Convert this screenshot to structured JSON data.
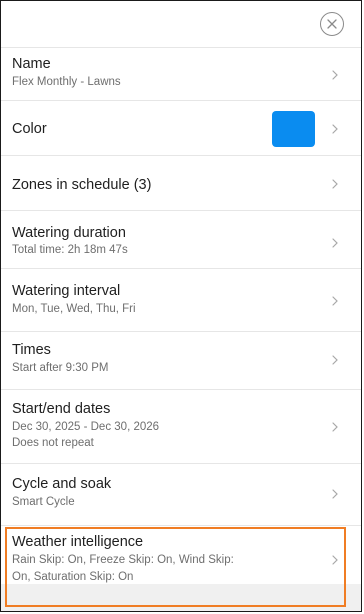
{
  "schedule": {
    "rows": [
      {
        "title": "Name",
        "subtitle": [
          "Flex Monthly - Lawns"
        ]
      },
      {
        "title": "Color",
        "subtitle": [],
        "swatch_color": "#0a8cf0"
      },
      {
        "title": "Zones in schedule (3)",
        "subtitle": []
      },
      {
        "title": "Watering duration",
        "subtitle": [
          "Total time: 2h 18m 47s"
        ]
      },
      {
        "title": "Watering interval",
        "subtitle": [
          "Mon, Tue, Wed, Thu, Fri"
        ]
      },
      {
        "title": "Times",
        "subtitle": [
          "Start after 9:30 PM"
        ]
      },
      {
        "title": "Start/end dates",
        "subtitle": [
          "Dec 30, 2025 - Dec 30, 2026",
          "Does not repeat"
        ]
      },
      {
        "title": "Cycle and soak",
        "subtitle": [
          "Smart Cycle"
        ]
      },
      {
        "title": "Weather intelligence",
        "subtitle": [
          "Rain Skip: On, Freeze Skip: On, Wind Skip:",
          "On, Saturation Skip: On"
        ]
      }
    ]
  },
  "icons": {
    "close": "close-icon",
    "chevron": "chevron-right-icon"
  },
  "colors": {
    "highlight": "#f07d24",
    "swatch": "#0a8cf0",
    "divider": "#e6e6e6"
  }
}
